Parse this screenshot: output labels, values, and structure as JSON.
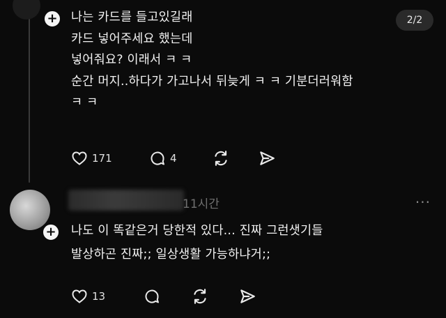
{
  "post": {
    "counter": "2/2",
    "lines": [
      "나는 카드를 들고있길래",
      "카드 넣어주세요 했는데",
      "넣어줘요? 이래서 ㅋ ㅋ",
      "순간 머지..하다가 가고나서 뒤늦게 ㅋ ㅋ 기분더러워함",
      "ㅋ ㅋ"
    ],
    "likes": "171",
    "replies": "4"
  },
  "reply": {
    "timestamp": "11시간",
    "more": "···",
    "lines": [
      "나도 이 똑같은거 당한적 있다... 진짜 그런샛기들",
      "발상하곤 진짜;; 일상생활 가능하냐거;;"
    ],
    "likes": "13"
  },
  "icons": {
    "like": "heart-icon",
    "comment": "comment-icon",
    "repost": "repost-icon",
    "share": "send-icon",
    "follow": "plus-icon"
  },
  "colors": {
    "background": "#0b0b0b",
    "text": "#f2f2f2",
    "muted": "#6f6f6f"
  }
}
